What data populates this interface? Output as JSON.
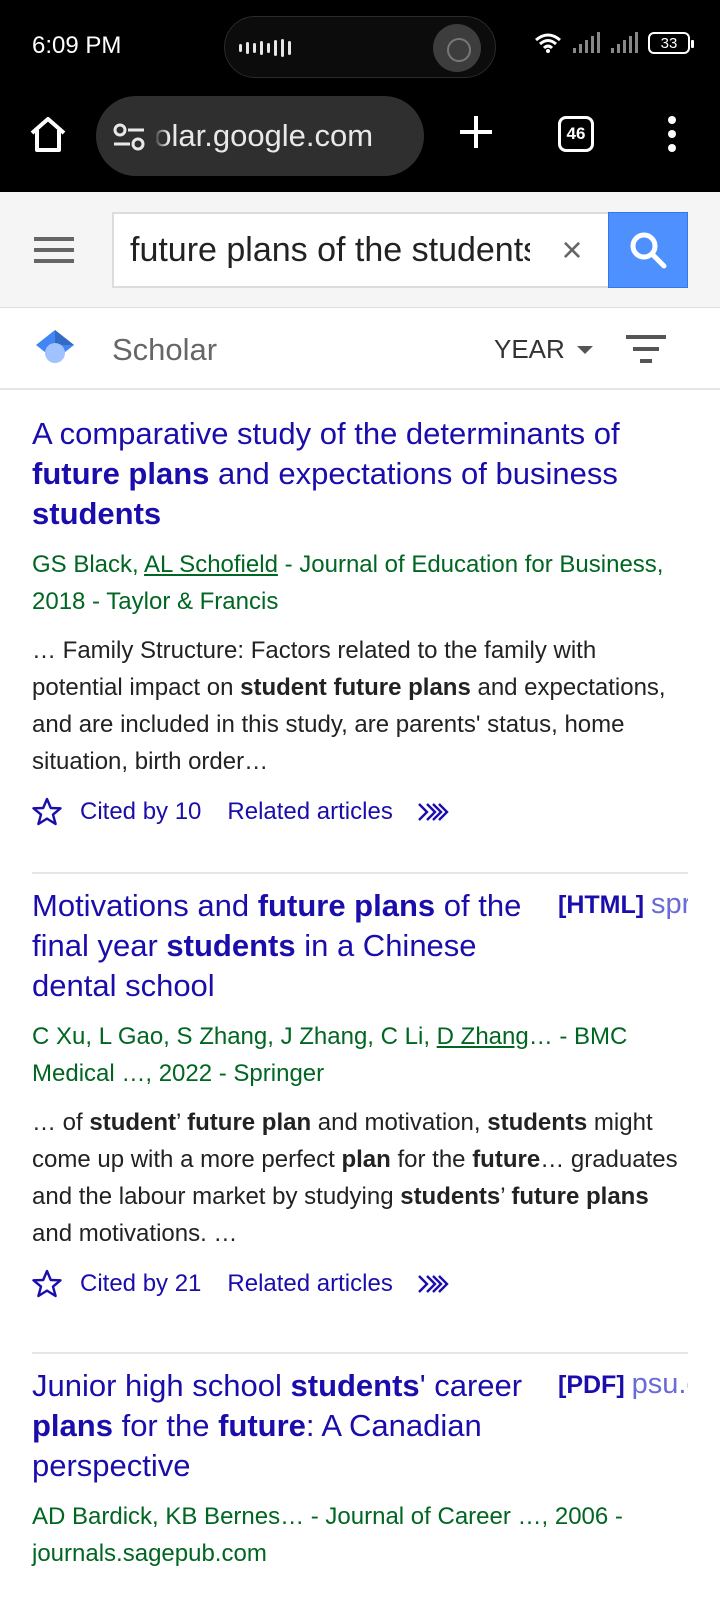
{
  "status_bar": {
    "time": "6:09 PM",
    "battery": "33"
  },
  "browser": {
    "url": "scholar.google.com",
    "tab_count": "46"
  },
  "search": {
    "query": "future plans of the students",
    "clear_symbol": "×"
  },
  "scholar_bar": {
    "label": "Scholar",
    "year_label": "YEAR"
  },
  "icons": {
    "home": "home-icon",
    "site_settings": "tune-icon",
    "new_tab": "plus-icon",
    "overflow": "more-vert-icon",
    "menu": "hamburger-icon",
    "search": "search-icon",
    "filter": "filter-icon",
    "save": "star-icon",
    "more": "double-chevron-icon"
  },
  "colors": {
    "link": "#1a0dab",
    "authors": "#006621",
    "search_button": "#4d90fe"
  },
  "results": [
    {
      "title": [
        {
          "t": "A comparative study of the determinants of ",
          "b": false
        },
        {
          "t": "future plans",
          "b": true
        },
        {
          "t": " and expectations of business ",
          "b": false
        },
        {
          "t": "students",
          "b": true
        }
      ],
      "authors": [
        {
          "t": "GS Black, ",
          "u": false
        },
        {
          "t": "AL Schofield",
          "u": true
        },
        {
          "t": " - Journal of Education for Business, 2018 - Taylor & Francis",
          "u": false
        }
      ],
      "snippet": [
        {
          "t": "… Family Structure: Factors related to the family with potential impact on ",
          "b": false
        },
        {
          "t": "student future plans",
          "b": true
        },
        {
          "t": " and expectations, and are included in this study, are parents' status, home situation, birth order…",
          "b": false
        }
      ],
      "cited": "Cited by 10",
      "related": "Related articles"
    },
    {
      "badge": {
        "type": "[HTML]",
        "source": "springer.com"
      },
      "title": [
        {
          "t": "Motivations and ",
          "b": false
        },
        {
          "t": "future plans",
          "b": true
        },
        {
          "t": " of the final year ",
          "b": false
        },
        {
          "t": "students",
          "b": true
        },
        {
          "t": " in a Chinese dental school",
          "b": false
        }
      ],
      "authors": [
        {
          "t": "C Xu, L Gao, S Zhang, J Zhang, C Li, ",
          "u": false
        },
        {
          "t": "D Zhang",
          "u": true
        },
        {
          "t": "… - BMC Medical …, 2022 - Springer",
          "u": false
        }
      ],
      "snippet": [
        {
          "t": "… of ",
          "b": false
        },
        {
          "t": "student",
          "b": true
        },
        {
          "t": "’ ",
          "b": false
        },
        {
          "t": "future plan",
          "b": true
        },
        {
          "t": " and motivation, ",
          "b": false
        },
        {
          "t": "students",
          "b": true
        },
        {
          "t": " might come up with a more perfect ",
          "b": false
        },
        {
          "t": "plan",
          "b": true
        },
        {
          "t": " for the ",
          "b": false
        },
        {
          "t": "future",
          "b": true
        },
        {
          "t": "… graduates and the labour market by studying ",
          "b": false
        },
        {
          "t": "students",
          "b": true
        },
        {
          "t": "’ ",
          "b": false
        },
        {
          "t": "future plans",
          "b": true
        },
        {
          "t": " and motivations. …",
          "b": false
        }
      ],
      "cited": "Cited by 21",
      "related": "Related articles"
    },
    {
      "badge": {
        "type": "[PDF]",
        "source": "psu.edu"
      },
      "title": [
        {
          "t": "Junior high school ",
          "b": false
        },
        {
          "t": "students",
          "b": true
        },
        {
          "t": "' career ",
          "b": false
        },
        {
          "t": "plans",
          "b": true
        },
        {
          "t": " for the ",
          "b": false
        },
        {
          "t": "future",
          "b": true
        },
        {
          "t": ": A Canadian perspective",
          "b": false
        }
      ],
      "authors": [
        {
          "t": "AD Bardick, KB Bernes… - Journal of Career …, 2006 - journals.sagepub.com",
          "u": false
        }
      ]
    }
  ]
}
